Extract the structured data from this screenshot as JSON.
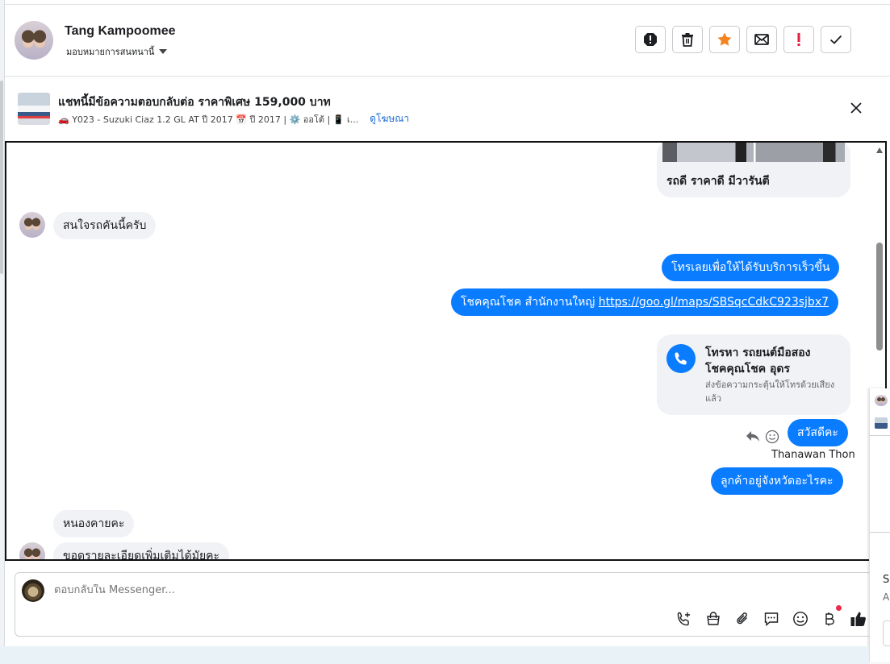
{
  "header": {
    "contact_name": "Tang Kampoomee",
    "assign_label": "มอบหมายการสนทนานี้",
    "actions": [
      "report-icon",
      "trash-icon",
      "star-icon",
      "mail-icon",
      "exclamation-icon",
      "check-icon"
    ],
    "accent_star": "#f5831f",
    "accent_alert": "#e41e3f"
  },
  "ad": {
    "title": "แชทนี้มีข้อความตอบกลับต่อ ราคาพิเศษ 159,000 บาท",
    "details": "🚗 Y023 - Suzuki Ciaz 1.2 GL AT ปี 2017 📅 ปี 2017 | ⚙️ ออโต้ | 📱 เ...",
    "view_ad": "ดูโฆษณา"
  },
  "chat": {
    "card_caption": "รถดี ราคาดี มีวารันตี",
    "msg_in_1": "สนใจรถคันนี้ครับ",
    "msg_out_1": "โทรเลยเพื่อให้ได้รับบริการเร็วขึ้น",
    "msg_out_2_prefix": "โชคคุณโชค สำนักงานใหญ่ ",
    "msg_out_2_link": "https://goo.gl/maps/SBSqcCdkC923sjbx7",
    "call_card_title": "โทรหา รถยนต์มือสอง\nโชคคุณโชค อุดร",
    "call_card_sub": "ส่งข้อความกระตุ้นให้โทรด้วยเสียงแล้ว",
    "msg_out_3": "สวัสดีคะ",
    "sender_name": "Thanawan Thon",
    "msg_out_4": "ลูกค้าอยู่จังหวัดอะไรคะ",
    "msg_in_2": "หนองคายคะ",
    "msg_in_3": "ขอดรายละเอียดเพิ่มเติมได้มัยคะ",
    "bubble_out_color": "#0a7cff",
    "bubble_in_color": "#f0f2f5"
  },
  "composer": {
    "placeholder": "ตอบกลับใน Messenger...",
    "tools": [
      "phone-plus-icon",
      "shopping-bag-icon",
      "paperclip-icon",
      "saved-reply-icon",
      "emoji-icon",
      "baht-icon",
      "thumbs-up-icon"
    ]
  },
  "side": {
    "s1": "S",
    "s2": "A"
  }
}
